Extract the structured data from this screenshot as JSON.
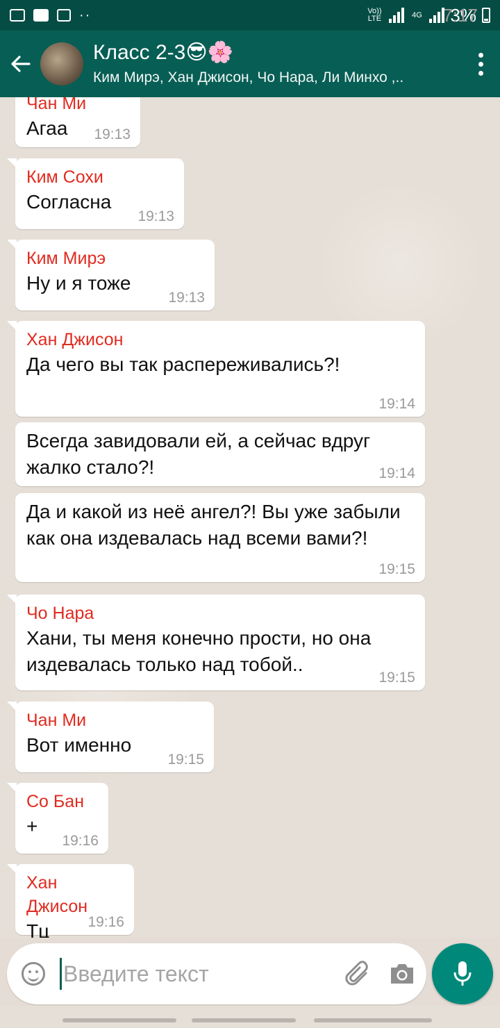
{
  "status_bar": {
    "time": "7:17",
    "volte": "Vo)) LTE",
    "network": "4G",
    "battery": "3%",
    "dots": "··"
  },
  "header": {
    "title": "Класс 2-3😎🌸",
    "subtitle": "Ким Мирэ, Хан Джисон, Чо Нара, Ли Минхо ,.."
  },
  "messages": [
    {
      "sender": "Чан Ми",
      "text": "Агаа",
      "time": "19:13"
    },
    {
      "sender": "Ким Сохи",
      "text": "Согласна",
      "time": "19:13"
    },
    {
      "sender": "Ким Мирэ",
      "text": "Ну и я тоже",
      "time": "19:13"
    },
    {
      "sender": "Хан Джисон",
      "text": "Да чего вы так распереживались?!",
      "time": "19:14"
    },
    {
      "sender": "",
      "text": "Всегда завидовали ей, а сейчас вдруг жалко стало?!",
      "time": "19:14"
    },
    {
      "sender": "",
      "text": "Да и какой из неё ангел?! Вы уже забыли как она издевалась над всеми вами?!",
      "time": "19:15"
    },
    {
      "sender": "Чо Нара",
      "text": "Хани, ты меня конечно прости, но она издевалась только над тобой..",
      "time": "19:15"
    },
    {
      "sender": "Чан Ми",
      "text": "Вот именно",
      "time": "19:15"
    },
    {
      "sender": "Со Бан",
      "text": "+",
      "time": "19:16"
    },
    {
      "sender": "Хан Джисон",
      "text": "Тц",
      "time": "19:16"
    }
  ],
  "input": {
    "placeholder": "Введите текст"
  },
  "colors": {
    "header": "#075e54",
    "status_bar": "#054d44",
    "sender": "#e02b20",
    "mic_button": "#00897b"
  }
}
